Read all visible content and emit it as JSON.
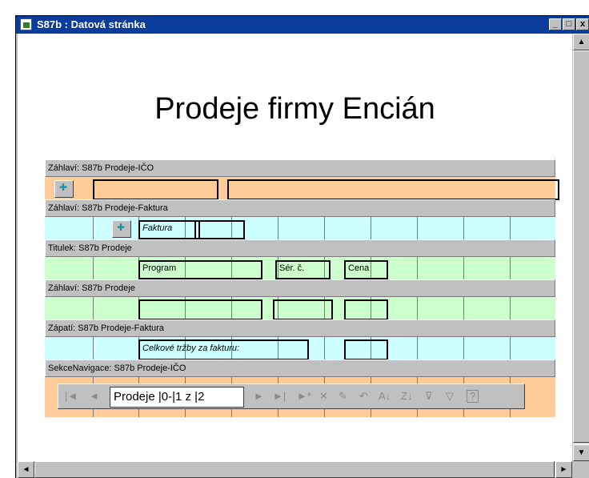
{
  "window": {
    "title": "S87b : Datová stránka",
    "minimize": "_",
    "maximize": "□",
    "close": "x"
  },
  "report": {
    "title": "Prodeje firmy Encián"
  },
  "bands": {
    "ico_header": "Záhlaví: S87b Prodeje-IČO",
    "faktura_header": "Záhlaví: S87b Prodeje-Faktura",
    "caption": "Titulek: S87b Prodeje",
    "prodeje_header": "Záhlaví: S87b Prodeje",
    "faktura_footer": "Zápatí: S87b Prodeje-Faktura",
    "navigation": "SekceNavigace: S87b Prodeje-IČO"
  },
  "fields": {
    "faktura": "Faktura",
    "program": "Program",
    "ser_c": "Sér. č.",
    "cena": "Cena",
    "total": "Celkové tržby za fakturu:"
  },
  "navigation": {
    "record_text": "Prodeje |0-|1 z |2",
    "first": "|◄",
    "prev": "◄",
    "next": "►",
    "last": "►|",
    "new": "►*",
    "delete": "✕",
    "save": "✎",
    "undo": "↶",
    "sort_asc": "A↓",
    "sort_desc": "Z↓",
    "filter": "⊽",
    "apply_filter": "▽",
    "help": "?"
  },
  "colors": {
    "orange": "#ffcc99",
    "cyan": "#ccffff",
    "green": "#ccffcc",
    "titlebar": "#0a3c9c"
  }
}
